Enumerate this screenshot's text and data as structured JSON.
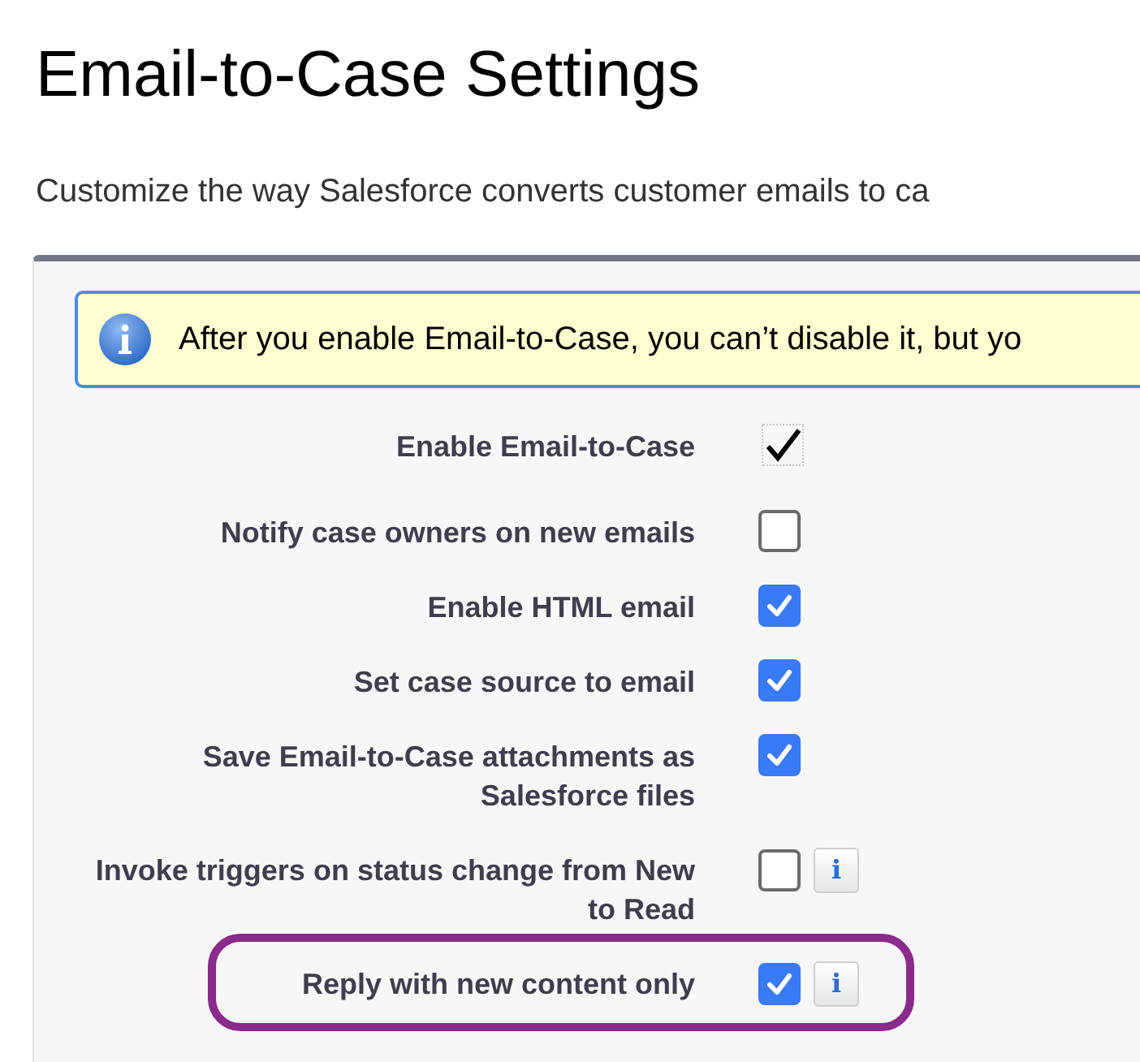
{
  "title": "Email-to-Case Settings",
  "description": "Customize the way Salesforce converts customer emails to ca",
  "info_message": "After you enable Email-to-Case, you can’t disable it, but yo",
  "settings": [
    {
      "label": "Enable Email-to-Case",
      "kind": "readonly",
      "checked": true,
      "info": false,
      "highlighted": false
    },
    {
      "label": "Notify case owners on new emails",
      "kind": "checkbox",
      "checked": false,
      "info": false,
      "highlighted": false
    },
    {
      "label": "Enable HTML email",
      "kind": "checkbox",
      "checked": true,
      "info": false,
      "highlighted": false
    },
    {
      "label": "Set case source to email",
      "kind": "checkbox",
      "checked": true,
      "info": false,
      "highlighted": false
    },
    {
      "label": "Save Email-to-Case attachments as Salesforce files",
      "kind": "checkbox",
      "checked": true,
      "info": false,
      "highlighted": false
    },
    {
      "label": "Invoke triggers on status change from New to Read",
      "kind": "checkbox",
      "checked": false,
      "info": true,
      "info_text": "i",
      "highlighted": false
    },
    {
      "label": "Reply with new content only",
      "kind": "checkbox",
      "checked": true,
      "info": true,
      "info_text": "i",
      "highlighted": true
    }
  ]
}
